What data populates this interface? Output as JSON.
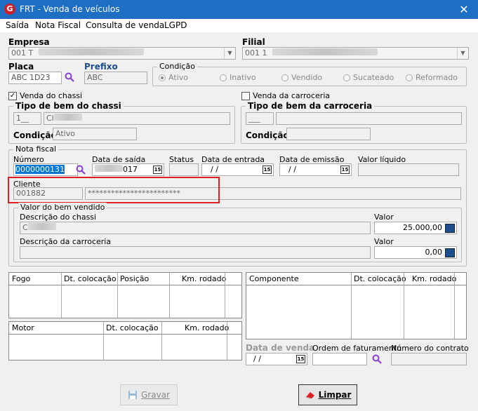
{
  "window": {
    "title": "FRT - Venda de veículos",
    "close": "✕",
    "app_icon": "G"
  },
  "menu": [
    "Saída",
    "Nota Fiscal",
    "Consulta de venda",
    "LGPD"
  ],
  "empresa": {
    "label": "Empresa",
    "value": "001 T"
  },
  "filial": {
    "label": "Filial",
    "value": "001 1"
  },
  "placa": {
    "label": "Placa",
    "value": "ABC 1D23"
  },
  "prefixo": {
    "label": "Prefixo",
    "value": "ABC"
  },
  "condicao": {
    "label": "Condição",
    "options": [
      "Ativo",
      "Inativo",
      "Vendido",
      "Sucateado",
      "Reformado"
    ],
    "selected": "Ativo"
  },
  "venda_chassi": {
    "label": "Venda do chassi",
    "checked": true
  },
  "venda_carroceria": {
    "label": "Venda da carroceria",
    "checked": false
  },
  "tipo_chassi": {
    "title": "Tipo de bem do chassi",
    "code": "1__",
    "name": "Cl",
    "cond_label": "Condição",
    "cond_value": "Ativo"
  },
  "tipo_carroceria": {
    "title": "Tipo de bem da carroceria",
    "code": "___",
    "cond_label": "Condição"
  },
  "nota": {
    "title": "Nota fiscal",
    "numero_label": "Número",
    "numero_value": "0000000131",
    "data_saida_label": "Data de saída",
    "data_saida_value": "017",
    "status_label": "Status",
    "data_entrada_label": "Data de entrada",
    "data_entrada_value": "/ /",
    "data_emissao_label": "Data de emissão",
    "data_emissao_value": "/ /",
    "valor_liquido_label": "Valor líquido",
    "cliente_label": "Cliente",
    "cliente_code": "001882",
    "cliente_name": "************************"
  },
  "valor_bem": {
    "title": "Valor do bem vendido",
    "desc_chassi_label": "Descrição do chassi",
    "desc_chassi_value": "C",
    "valor_label": "Valor",
    "valor_chassi": "25.000,00",
    "desc_carroceria_label": "Descrição da carroceria",
    "valor_carroceria_label": "Valor",
    "valor_carroceria": "0,00"
  },
  "grid_fogo": [
    "Fogo",
    "Dt. colocação",
    "Posição",
    "Km. rodado"
  ],
  "grid_motor": [
    "Motor",
    "Dt. colocação",
    "Km. rodado"
  ],
  "grid_componente": [
    "Componente",
    "Dt. colocação",
    "Km. rodado"
  ],
  "venda": {
    "data_venda_label": "Data de venda",
    "data_venda_value": "/ /",
    "ordem_label": "Ordem de faturamento",
    "contrato_label": "Número do contrato"
  },
  "cal_icon_text": "15",
  "buttons": {
    "gravar": "Gravar",
    "limpar": "Limpar"
  },
  "colors": {
    "titlebar": "#1e6ec3",
    "highlight": "#e02020",
    "accent_purple": "#8a3fd1"
  }
}
